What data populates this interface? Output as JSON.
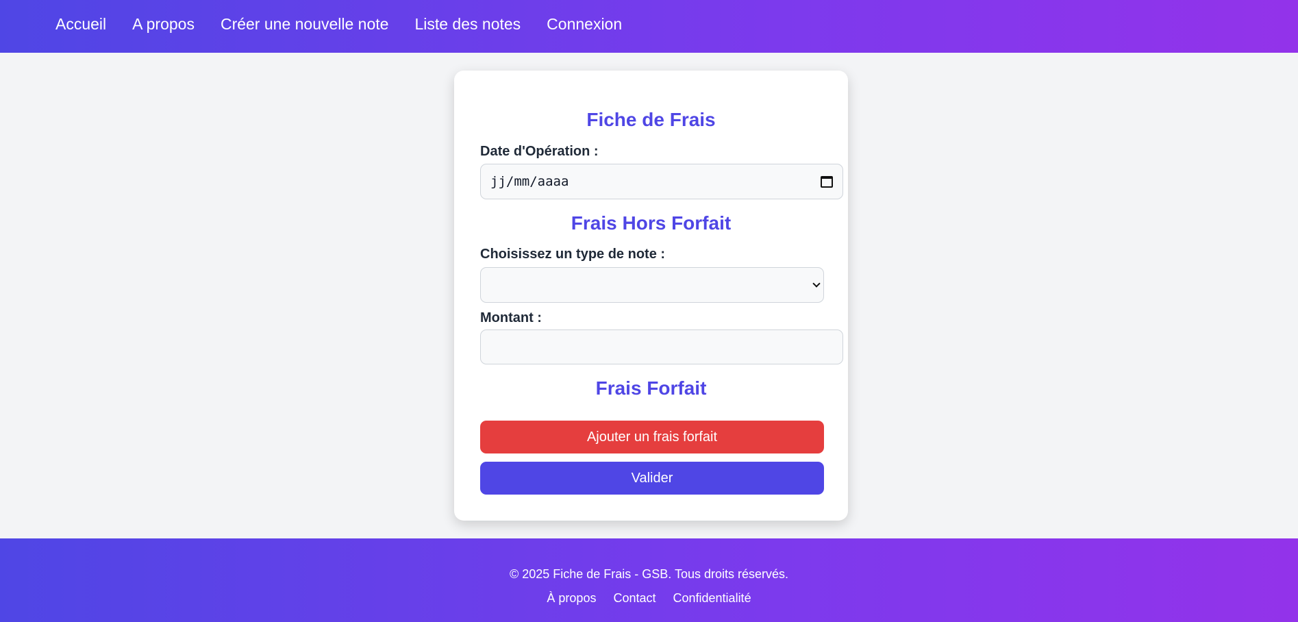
{
  "nav": {
    "items": [
      {
        "label": "Accueil"
      },
      {
        "label": "A propos"
      },
      {
        "label": "Créer une nouvelle note"
      },
      {
        "label": "Liste des notes"
      },
      {
        "label": "Connexion"
      }
    ]
  },
  "form": {
    "title": "Fiche de Frais",
    "date_label": "Date d'Opération :",
    "date_placeholder": "jj/mm/aaaa",
    "hors_forfait_title": "Frais Hors Forfait",
    "type_label": "Choisissez un type de note :",
    "type_value": "",
    "montant_label": "Montant :",
    "montant_value": "",
    "forfait_title": "Frais Forfait",
    "add_forfait_button": "Ajouter un frais forfait",
    "submit_button": "Valider"
  },
  "footer": {
    "copyright": "© 2025 Fiche de Frais - GSB. Tous droits réservés.",
    "links": [
      {
        "label": "À propos"
      },
      {
        "label": "Contact"
      },
      {
        "label": "Confidentialité"
      }
    ]
  },
  "colors": {
    "accent": "#4f46e5",
    "gradient_end": "#9333ea",
    "danger": "#e53e3e",
    "background": "#f3f4f6"
  },
  "icons": {
    "date_picker": "calendar-icon",
    "select_arrow": "chevron-down-icon"
  }
}
